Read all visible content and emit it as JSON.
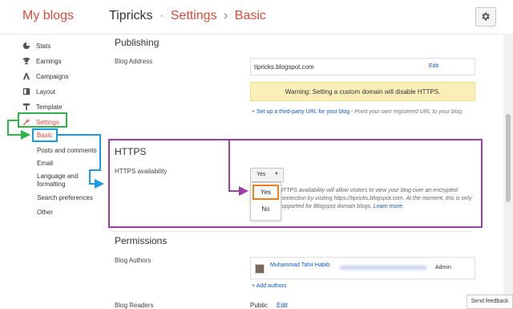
{
  "header": {
    "app_title": "My blogs",
    "blog_name": "Tipricks",
    "sep1": "·",
    "section": "Settings",
    "sep2": "›",
    "page": "Basic",
    "gear_icon": "gear-icon"
  },
  "sidebar": {
    "items": [
      {
        "label": "Stats",
        "icon": "stats-pie-icon"
      },
      {
        "label": "Earnings",
        "icon": "trophy-icon"
      },
      {
        "label": "Campaigns",
        "icon": "campaigns-icon"
      },
      {
        "label": "Layout",
        "icon": "layout-icon"
      },
      {
        "label": "Template",
        "icon": "template-icon"
      },
      {
        "label": "Settings",
        "icon": "wrench-icon"
      }
    ],
    "sub_items": [
      "Basic",
      "Posts and comments",
      "Email",
      "Language and formatting",
      "Search preferences",
      "Other"
    ]
  },
  "publishing": {
    "title": "Publishing",
    "blog_address_label": "Blog Address",
    "blog_address_value": "tipricks.blogspot.com",
    "edit_label": "Edit",
    "warning": "Warning: Setting a custom domain will disable HTTPS.",
    "setup_link": "+ Set up a third-party URL for your blog",
    "setup_note": " - Point your own registered URL to your blog."
  },
  "https": {
    "title": "HTTPS",
    "availability_label": "HTTPS availability",
    "selected_value": "Yes",
    "options": [
      "Yes",
      "No"
    ],
    "description": "HTTPS availability will allow visitors to view your blog over an encrypted connection by visiting https://tipricks.blogspot.com. At the moment, this is only supported for Blogspot domain blogs.",
    "learn_more": "Learn more."
  },
  "permissions": {
    "title": "Permissions",
    "blog_authors_label": "Blog Authors",
    "author_name": "Muhammad Tahir Habib",
    "author_role": "Admin",
    "add_authors": "+ Add authors",
    "blog_readers_label": "Blog Readers",
    "readers_value": "Public",
    "readers_edit": "Edit"
  },
  "footer": {
    "send_feedback": "Send feedback"
  },
  "annotation_colors": {
    "green": "#2fb34a",
    "blue": "#1a9be0",
    "purple": "#9b3fa8",
    "orange": "#f07d1a"
  }
}
